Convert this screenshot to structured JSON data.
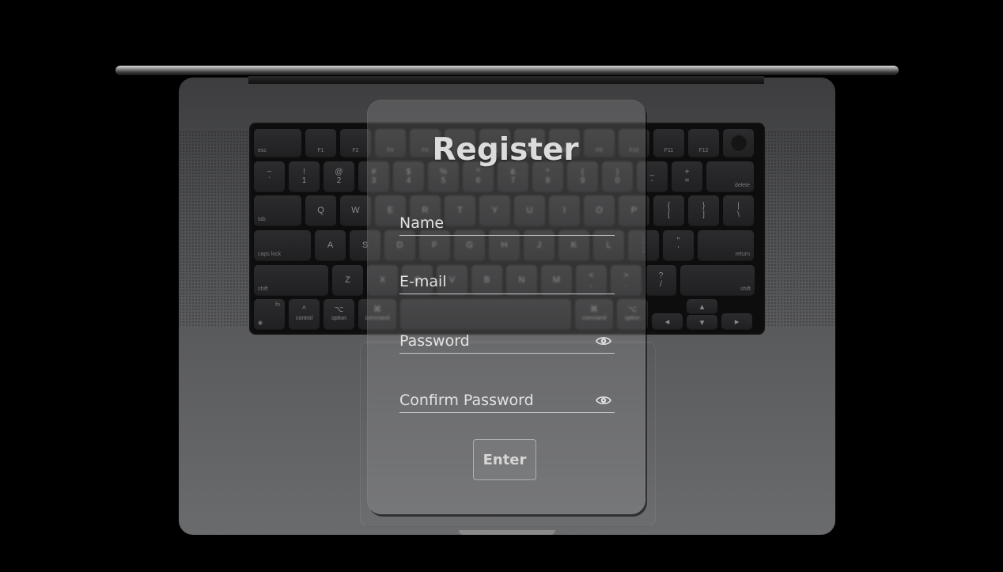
{
  "form": {
    "title": "Register",
    "fields": [
      {
        "label": "Name",
        "has_toggle": false
      },
      {
        "label": "E-mail",
        "has_toggle": false
      },
      {
        "label": "Password",
        "has_toggle": true,
        "toggle_icon": "eye-icon"
      },
      {
        "label": "Confirm Password",
        "has_toggle": true,
        "toggle_icon": "eye-icon"
      }
    ],
    "submit_label": "Enter"
  },
  "keyboard": {
    "fn_row": [
      "esc",
      "F1",
      "F2",
      "F3",
      "F4",
      "F5",
      "F6",
      "F7",
      "F8",
      "F9",
      "F10",
      "F11",
      "F12"
    ],
    "number_row": [
      {
        "top": "~",
        "bottom": "`"
      },
      {
        "top": "!",
        "bottom": "1"
      },
      {
        "top": "@",
        "bottom": "2"
      },
      {
        "top": "#",
        "bottom": "3"
      },
      {
        "top": "$",
        "bottom": "4"
      },
      {
        "top": "%",
        "bottom": "5"
      },
      {
        "top": "^",
        "bottom": "6"
      },
      {
        "top": "&",
        "bottom": "7"
      },
      {
        "top": "*",
        "bottom": "8"
      },
      {
        "top": "(",
        "bottom": "9"
      },
      {
        "top": ")",
        "bottom": "0"
      },
      {
        "top": "_",
        "bottom": "-"
      },
      {
        "top": "+",
        "bottom": "="
      }
    ],
    "delete_label": "delete",
    "tab_label": "tab",
    "qwerty_row": [
      "Q",
      "W",
      "E",
      "R",
      "T",
      "Y",
      "U",
      "I",
      "O",
      "P"
    ],
    "qwerty_extra": [
      {
        "top": "{",
        "bottom": "["
      },
      {
        "top": "}",
        "bottom": "]"
      },
      {
        "top": "|",
        "bottom": "\\"
      }
    ],
    "caps_label": "caps lock",
    "home_row": [
      "A",
      "S",
      "D",
      "F",
      "G",
      "H",
      "J",
      "K",
      "L"
    ],
    "home_extra": [
      {
        "top": ":",
        "bottom": ";"
      },
      {
        "top": "\"",
        "bottom": "'"
      }
    ],
    "return_label": "return",
    "shift_label": "shift",
    "bottom_letters": [
      "Z",
      "X",
      "C",
      "V",
      "B",
      "N",
      "M"
    ],
    "bottom_extra": [
      {
        "top": "<",
        "bottom": ","
      },
      {
        "top": ">",
        "bottom": "."
      },
      {
        "top": "?",
        "bottom": "/"
      }
    ],
    "mod_row": [
      {
        "top": "fn",
        "bottom": ""
      },
      {
        "top": "^",
        "bottom": "control"
      },
      {
        "top": "⌥",
        "bottom": "option"
      },
      {
        "top": "⌘",
        "bottom": "command"
      }
    ],
    "mod_row_right": [
      {
        "top": "⌘",
        "bottom": "command"
      },
      {
        "top": "⌥",
        "bottom": "option"
      }
    ]
  }
}
